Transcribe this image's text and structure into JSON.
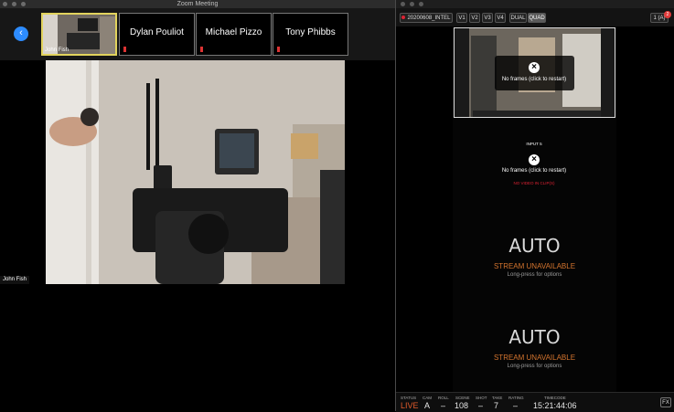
{
  "zoom": {
    "window_title": "Zoom Meeting",
    "active_participant": "John Fish",
    "participants": [
      "Dylan Pouliot",
      "Michael Pizzo",
      "Tony Phibbs"
    ],
    "main_label": "John Fish"
  },
  "monitor": {
    "project": "20200608_INTEL",
    "view_buttons": [
      "V1",
      "V2",
      "V3",
      "V4",
      "DUAL",
      "QUAD"
    ],
    "selected_view": "QUAD",
    "counter": "1 (A)",
    "badge": "2",
    "no_frames": "No frames (click to restart)",
    "input_label": "INPUT 5",
    "input_status": "NO VIDEO IN CLIP(S)",
    "streams": [
      {
        "mode": "AUTO",
        "status": "STREAM UNAVAILABLE",
        "hint": "Long-press for options"
      },
      {
        "mode": "AUTO",
        "status": "STREAM UNAVAILABLE",
        "hint": "Long-press for options"
      }
    ],
    "statusbar": {
      "status_label": "STATUS",
      "status": "LIVE",
      "cam_label": "CAM",
      "cam": "A",
      "roll_label": "ROLL",
      "roll": "–",
      "scene_label": "SCENE",
      "scene": "108",
      "shot_label": "SHOT",
      "shot": "–",
      "take_label": "TAKE",
      "take": "7",
      "rating_label": "RATING",
      "rating": "–",
      "timecode_label": "TIMECODE",
      "timecode": "15:21:44:06"
    },
    "fx_label": "FX"
  },
  "colors": {
    "live": "#e05a2b",
    "stream_unavailable": "#d4742e",
    "zoom_blue": "#2d8cff",
    "active_border": "#e2d35d"
  }
}
